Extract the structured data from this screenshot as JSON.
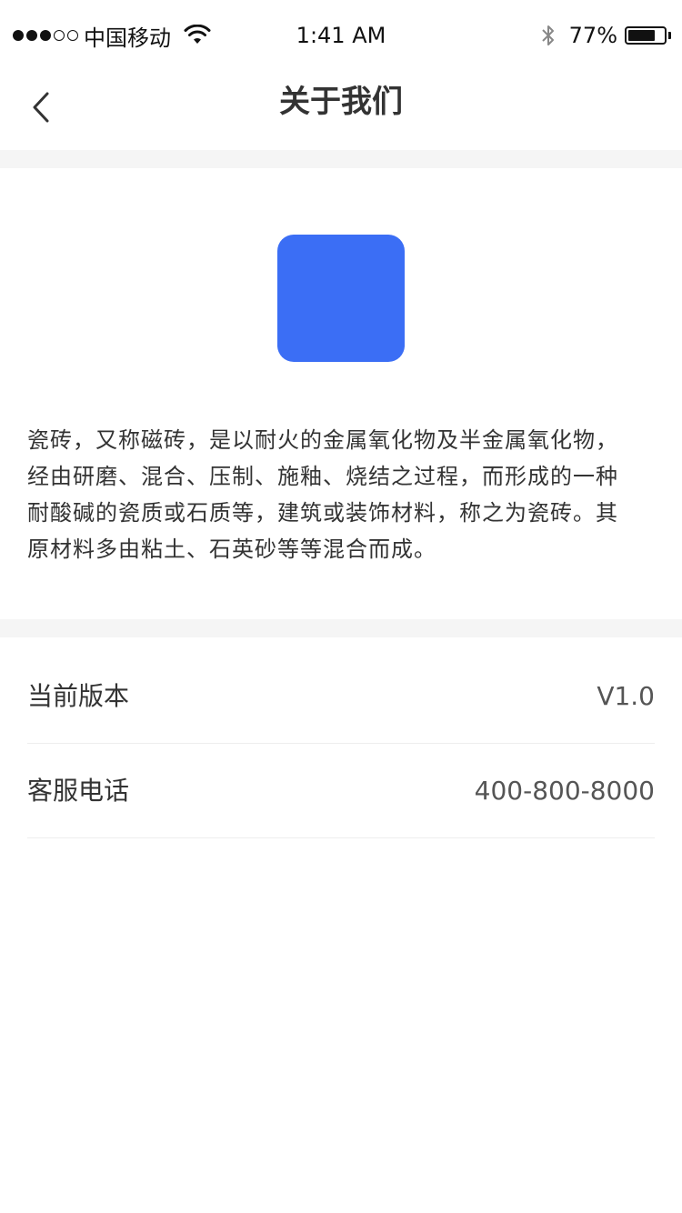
{
  "status_bar": {
    "carrier": "中国移动",
    "time": "1:41 AM",
    "battery_percent": "77%",
    "battery_level": 0.77,
    "signal_bars_filled": 3,
    "signal_bars_total": 5
  },
  "nav": {
    "title": "关于我们",
    "back_icon": "chevron-left-icon"
  },
  "app": {
    "logo_color": "#3b6ef5",
    "description": "瓷砖，又称磁砖，是以耐火的金属氧化物及半金属氧化物，\n经由研磨、混合、压制、施釉、烧结之过程，而形成的一种\n耐酸碱的瓷质或石质等，建筑或装饰材料，称之为瓷砖。其\n原材料多由粘土、石英砂等等混合而成。"
  },
  "info": {
    "version_label": "当前版本",
    "version_value": "V1.0",
    "phone_label": "客服电话",
    "phone_value": "400-800-8000"
  }
}
